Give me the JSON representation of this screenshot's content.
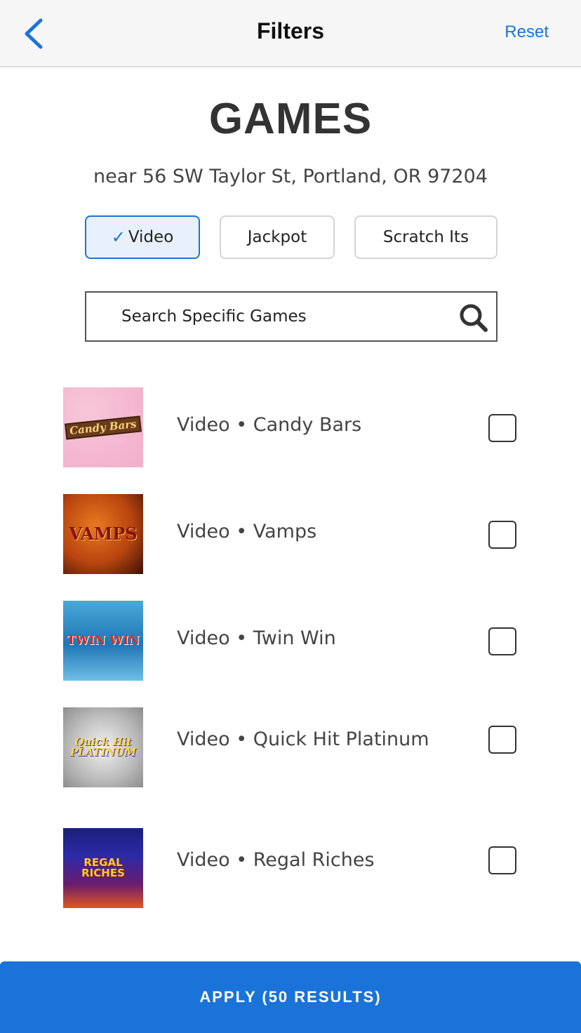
{
  "header": {
    "back_icon": "chevron-left-icon",
    "title": "Filters",
    "reset_label": "Reset"
  },
  "section": {
    "title": "GAMES",
    "location": "near 56 SW Taylor St, Portland, OR 97204"
  },
  "filters": [
    {
      "label": "Video",
      "selected": true
    },
    {
      "label": "Jackpot",
      "selected": false
    },
    {
      "label": "Scratch Its",
      "selected": false
    }
  ],
  "search": {
    "placeholder": "Search Specific Games",
    "value": "",
    "icon": "search-icon"
  },
  "games": [
    {
      "label": "Video • Candy Bars",
      "thumb_text": "Candy Bars",
      "checked": false
    },
    {
      "label": "Video • Vamps",
      "thumb_text": "VAMPS",
      "checked": false
    },
    {
      "label": "Video • Twin Win",
      "thumb_text": "TWIN WIN",
      "checked": false
    },
    {
      "label": "Video • Quick Hit Platinum",
      "thumb_text": "Quick Hit PLATINUM",
      "checked": false
    },
    {
      "label": "Video • Regal Riches",
      "thumb_text": "REGAL RICHES",
      "checked": false
    }
  ],
  "apply": {
    "label": "APPLY (50 RESULTS)"
  },
  "colors": {
    "accent": "#1a73d9",
    "header_bg": "#f6f6f6",
    "text": "#333333"
  }
}
